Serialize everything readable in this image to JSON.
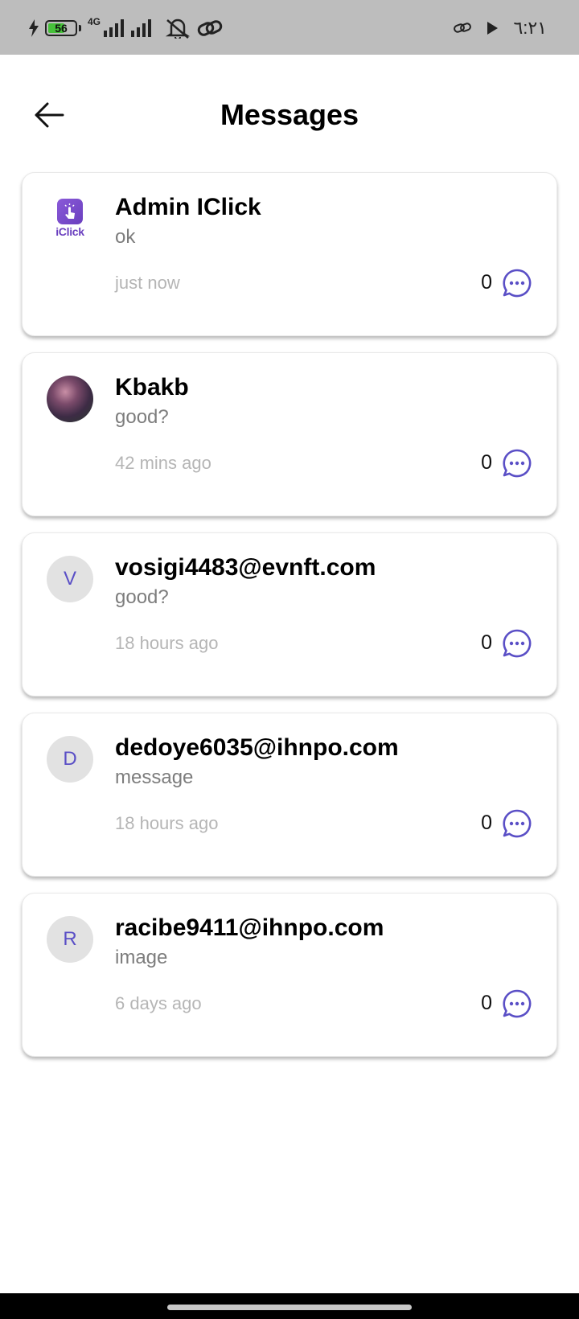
{
  "status_bar": {
    "battery": "56",
    "network": "4G",
    "time": "٦:٢١"
  },
  "header": {
    "title": "Messages"
  },
  "conversations": [
    {
      "name": "Admin IClick",
      "message": "ok",
      "time": "just now",
      "count": "0",
      "avatar_type": "logo",
      "logo_text": "iClick"
    },
    {
      "name": "Kbakb",
      "message": "good?",
      "time": "42 mins ago",
      "count": "0",
      "avatar_type": "photo"
    },
    {
      "name": "vosigi4483@evnft.com",
      "message": "good?",
      "time": "18 hours ago",
      "count": "0",
      "avatar_type": "letter",
      "initial": "V"
    },
    {
      "name": "dedoye6035@ihnpo.com",
      "message": "message",
      "time": "18 hours ago",
      "count": "0",
      "avatar_type": "letter",
      "initial": "D"
    },
    {
      "name": "racibe9411@ihnpo.com",
      "message": "image",
      "time": "6 days ago",
      "count": "0",
      "avatar_type": "letter",
      "initial": "R"
    }
  ],
  "colors": {
    "accent": "#5a4fc6",
    "brand_purple": "#6a3fbf",
    "status_bar_bg": "#bdbdbd",
    "battery_green": "#46c13a"
  },
  "icons": [
    "charging-bolt-icon",
    "battery-icon",
    "signal-icon",
    "mute-icon",
    "link-icon",
    "play-icon",
    "back-arrow-icon",
    "chat-bubble-icon"
  ]
}
